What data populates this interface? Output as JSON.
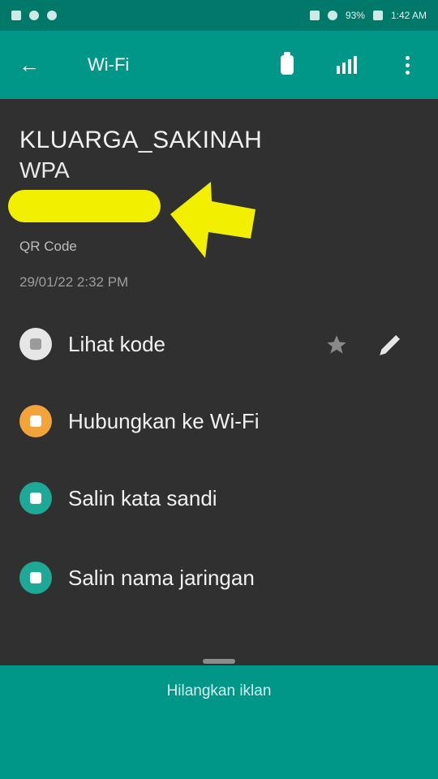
{
  "status_bar": {
    "left_icons": [
      "cast-icon",
      "usb-icon",
      "android-icon"
    ],
    "right_icons": [
      "signal-icon",
      "wifi-icon"
    ],
    "battery": "93%",
    "time": "1:42 AM"
  },
  "toolbar": {
    "title": "Wi-Fi",
    "icons": [
      "back-arrow-icon",
      "clipboard-icon",
      "scan-icon",
      "more-vert-icon"
    ]
  },
  "network": {
    "ssid": "KLUARGA_SAKINAH",
    "security": "WPA",
    "source": "QR Code",
    "datetime": "29/01/22 2:32 PM"
  },
  "actions": [
    {
      "label": "Lihat kode",
      "icon": "qr-view-icon"
    },
    {
      "label": "Hubungkan ke Wi-Fi",
      "icon": "wifi-connect-icon"
    },
    {
      "label": "Salin kata sandi",
      "icon": "copy-password-icon"
    },
    {
      "label": "Salin nama jaringan",
      "icon": "copy-network-name-icon"
    }
  ],
  "row_icons": {
    "favorite": "star-icon",
    "edit": "pencil-icon"
  },
  "bottom_button": {
    "label": "Hilangkan iklan"
  },
  "colors": {
    "primary": "#009688",
    "status_bar": "#00796b",
    "background": "#303030",
    "highlight": "#f2f000",
    "orange": "#f2a33a",
    "teal": "#1ea896"
  }
}
